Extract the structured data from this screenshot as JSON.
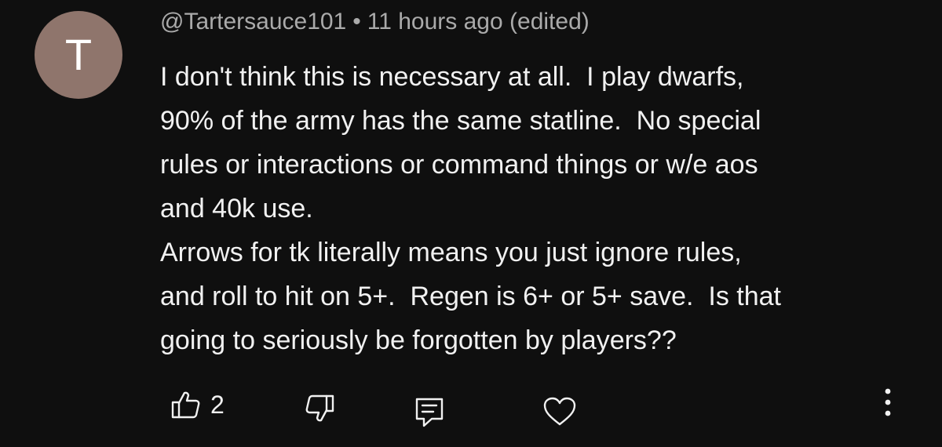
{
  "comment": {
    "avatar_letter": "T",
    "avatar_color": "#8f756c",
    "author": "@Tartersauce101",
    "separator": "•",
    "timestamp": "11 hours ago",
    "edited_label": "(edited)",
    "text_lines": [
      "I don't think this is necessary at all.  I play dwarfs,",
      "90% of the army has the same statline.  No special",
      "rules or interactions or command things or w/e aos",
      "and 40k use.",
      "Arrows for tk literally means you just ignore rules,",
      "and roll to hit on 5+.  Regen is 6+ or 5+ save.  Is that",
      "going to seriously be forgotten by players??"
    ],
    "like_count": "2",
    "icons": {
      "like": "thumbs-up-icon",
      "dislike": "thumbs-down-icon",
      "reply": "reply-icon",
      "heart": "heart-icon",
      "more": "more-vertical-icon"
    }
  },
  "colors": {
    "background": "#0f0f0f",
    "text": "#f1f1f1",
    "meta_text": "#aaaaaa"
  }
}
